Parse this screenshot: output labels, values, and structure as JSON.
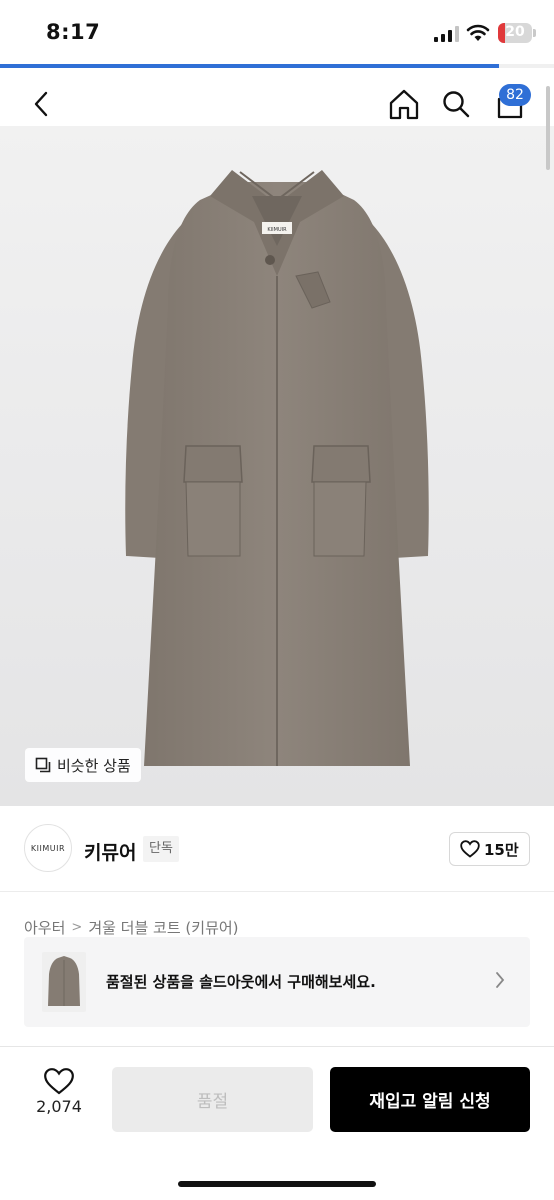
{
  "status_bar": {
    "time": "8:17",
    "battery": "20",
    "battery_level": 0.2,
    "page_load_progress": 0.9
  },
  "header": {
    "cart_count": "82",
    "icons": [
      "back-icon",
      "home-icon",
      "search-icon",
      "shopping-bag-icon"
    ]
  },
  "product_image": {
    "label_on_coat": "KIIMUIR",
    "similar_button_label": "비슷한 상품"
  },
  "brand": {
    "logo_text": "KIIMUIR",
    "name": "키뮤어",
    "tag": "단독",
    "likes": "15만"
  },
  "breadcrumb": {
    "category": "아우터",
    "separator": ">",
    "product_name": "겨울 더블 코트 (키뮤어)"
  },
  "soldout_banner": {
    "text": "품절된 상품을 솔드아웃에서 구매해보세요."
  },
  "bottom_bar": {
    "wishlist_count": "2,074",
    "soldout_label": "품절",
    "restock_label": "재입고 알림 신청"
  },
  "colors": {
    "accent_blue": "#2f6fd6",
    "coat": "#8b8178",
    "battery_red": "#e0393b"
  }
}
